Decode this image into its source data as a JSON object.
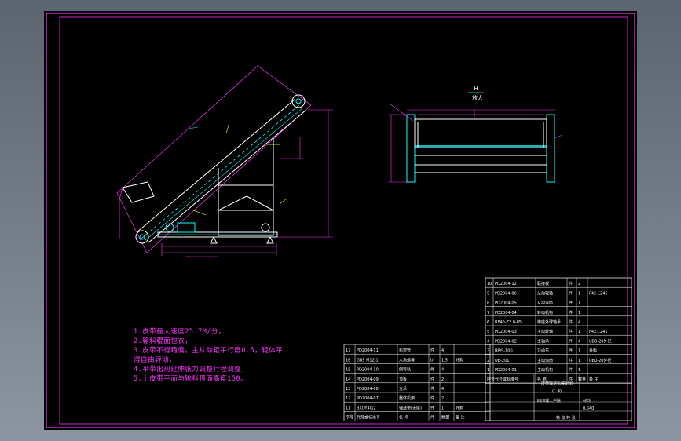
{
  "view_label": {
    "mark": "H",
    "text": "放大"
  },
  "notes": [
    "1.皮带最大速度25.7M/分，",
    "2.输料辊面包衣，",
    "3.皮带不得跑偏，主从动辊平行度0.5，辊体平",
    "得自由转动，",
    "4.平带出现延伸张力调整行程调整，",
    "5.上皮带平面与输料顶面高度150。"
  ],
  "bom_left": [
    {
      "no": "17",
      "code": "PD2004-11",
      "name": "机架管",
      "mat": "件",
      "qty": "4",
      "note": ""
    },
    {
      "no": "16",
      "code": "GB5 M12-1",
      "name": "六角螺母",
      "mat": "U",
      "qty": "1.5",
      "note": "外购"
    },
    {
      "no": "15",
      "code": "PD2004-10",
      "name": "侧导轨",
      "mat": "件",
      "qty": "4",
      "note": ""
    },
    {
      "no": "14",
      "code": "PD2004-09",
      "name": "顶板",
      "mat": "件",
      "qty": "2",
      "note": ""
    },
    {
      "no": "13",
      "code": "PD2004-08",
      "name": "支承",
      "mat": "件",
      "qty": "4",
      "note": ""
    },
    {
      "no": "12",
      "code": "PD2004-07",
      "name": "整体机架",
      "mat": "件",
      "qty": "2",
      "note": ""
    },
    {
      "no": "11",
      "code": "BXDY40/2",
      "name": "输送带(无缝)",
      "mat": "件",
      "qty": "1",
      "note": "外购"
    }
  ],
  "bom_left_head": {
    "no": "序号",
    "code": "代号或标准号",
    "name": "名 称",
    "mat": "件",
    "qty": "数量",
    "note": "备 注"
  },
  "bom_right": [
    {
      "no": "10",
      "code": "PD2004-12",
      "name": "联接板",
      "mat": "件",
      "qty": "2",
      "note": ""
    },
    {
      "no": "9",
      "code": "PD2004-06",
      "name": "从动辊轴",
      "mat": "件",
      "qty": "1",
      "note": "F42.1245"
    },
    {
      "no": "8",
      "code": "PD2004-05",
      "name": "从动滚筒",
      "mat": "件",
      "qty": "1",
      "note": ""
    },
    {
      "no": "7",
      "code": "PD2004-04",
      "name": "转动机构",
      "mat": "件",
      "qty": "1",
      "note": ""
    },
    {
      "no": "6",
      "code": "RF40-Z3.0-85",
      "name": "带座外球轴承",
      "mat": "件",
      "qty": "4",
      "note": ""
    },
    {
      "no": "5",
      "code": "PD2004-03",
      "name": "主动辊轴",
      "mat": "件",
      "qty": "1",
      "note": "F42.1241"
    },
    {
      "no": "4",
      "code": "PD2004-02",
      "name": "主轴承",
      "mat": "件",
      "qty": "4",
      "note": "UB0-20外径"
    },
    {
      "no": "3",
      "code": "BP/9-100",
      "name": "万向节",
      "mat": "件",
      "qty": "1",
      "note": "外购"
    },
    {
      "no": "2",
      "code": "UB-201",
      "name": "主动滚筒",
      "mat": "件",
      "qty": "1",
      "note": "UB0-20外径"
    },
    {
      "no": "1",
      "code": "PD2004-01",
      "name": "主动机构",
      "mat": "件",
      "qty": "1",
      "note": ""
    }
  ],
  "bom_right_head": {
    "no": "序号",
    "code": "代号或标准号",
    "name": "名 称",
    "mat": "件",
    "qty": "数量",
    "note": "备 注"
  },
  "title_block": {
    "name": "皮带输送机装配图",
    "scale": "(1:4)",
    "school": "四川理工学院",
    "mass": "0.340",
    "sheet": "第 张 共 张",
    "material": "材料"
  }
}
